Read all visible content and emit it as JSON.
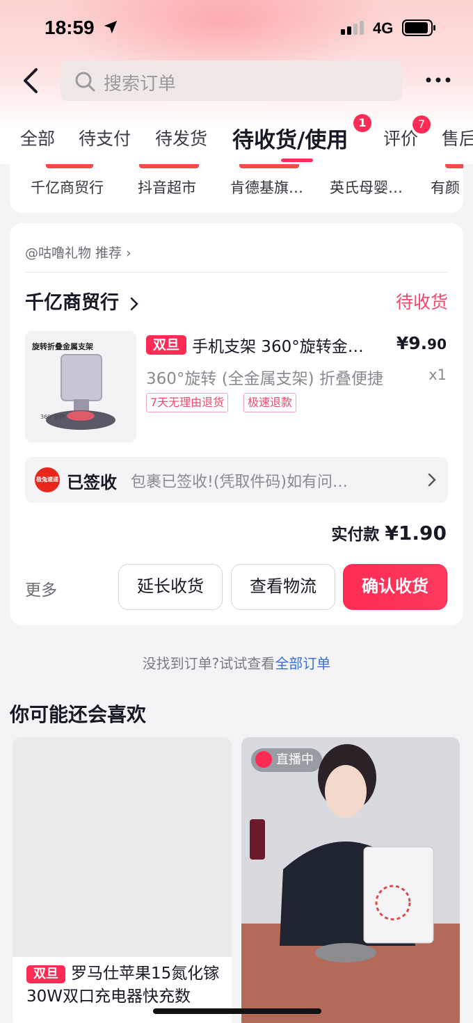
{
  "status_bar": {
    "time": "18:59",
    "network": "4G"
  },
  "search": {
    "placeholder": "搜索订单"
  },
  "tabs": [
    {
      "label": "全部"
    },
    {
      "label": "待支付"
    },
    {
      "label": "待发货"
    },
    {
      "label": "待收货/使用",
      "badge": "1"
    },
    {
      "label": "评价",
      "badge": "7"
    },
    {
      "label": "售后"
    }
  ],
  "shops_row": [
    "千亿商贸行",
    "抖音超市",
    "肯德基旗…",
    "英氏母婴…",
    "有颜"
  ],
  "order": {
    "recommend": "@咕噜礼物 推荐 ›",
    "shop_name": "千亿商贸行",
    "status": "待收货",
    "thumb_title": "旋转折叠金属支架",
    "thumb_caption": "360°旋转",
    "badge": "双旦",
    "title": "手机支架 360°旋转金…",
    "price_main": "¥9.",
    "price_cents": "90",
    "spec": "360°旋转 (全金属支架) 折叠便捷",
    "qty": "x1",
    "tags": [
      "7天无理由退货",
      "极速退款"
    ],
    "logistics": {
      "logo": "极兔速递",
      "status": "已签收",
      "desc": "包裹已签收!(凭取件码)如有问…"
    },
    "paid_label": "实付款",
    "paid_amount": "¥1.90",
    "more": "更多",
    "buttons": {
      "extend": "延长收货",
      "track": "查看物流",
      "confirm": "确认收货"
    }
  },
  "not_found": {
    "text": "没找到订单?试试查看",
    "link": "全部订单"
  },
  "recommend_section": {
    "title": "你可能还会喜欢",
    "item1": {
      "badge": "双旦",
      "title": "罗马仕苹果15氮化镓30W双口充电器快充数"
    },
    "item2": {
      "live": "直播中"
    }
  },
  "colors": {
    "accent": "#fe2c55",
    "link": "#3a6fd8"
  }
}
